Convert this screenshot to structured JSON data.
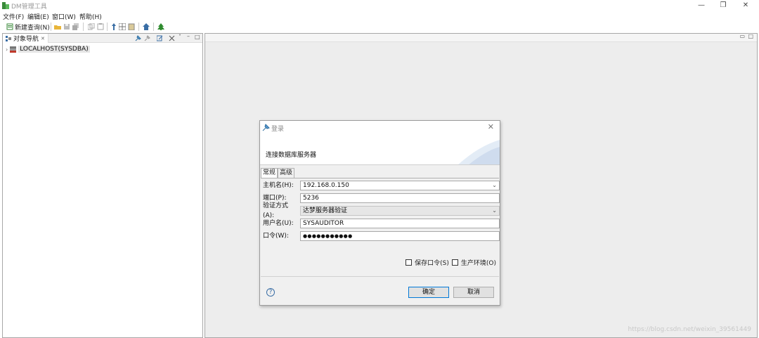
{
  "window": {
    "title": "DM管理工具",
    "minimize": "—",
    "maximize": "❐",
    "close": "✕"
  },
  "menu": [
    "文件(F)",
    "编辑(E)",
    "窗口(W)",
    "帮助(H)"
  ],
  "toolbar": {
    "new_query_label": "新建查询(N)",
    "icons": [
      "open-folder-icon",
      "save-icon",
      "save-all-icon",
      "copy-icon",
      "paste-icon",
      "pin-icon",
      "grid-icon",
      "clipboard-icon",
      "home-icon",
      "tree-icon"
    ]
  },
  "navigator": {
    "tab_label": "对象导航",
    "tab_close": "✕",
    "tree": [
      {
        "label": "LOCALHOST(SYSDBA)",
        "expander": "›"
      }
    ]
  },
  "dialog": {
    "title": "登录",
    "close": "✕",
    "subtitle": "连接数据库服务器",
    "tabs": [
      {
        "label": "常规",
        "active": true
      },
      {
        "label": "高级",
        "active": false
      }
    ],
    "fields": {
      "host": {
        "label": "主机名(H):",
        "value": "192.168.0.150",
        "dropdown": true
      },
      "port": {
        "label": "端口(P):",
        "value": "5236"
      },
      "auth": {
        "label": "验证方式(A):",
        "value": "达梦服务器验证",
        "dropdown": true,
        "disabled": true
      },
      "user": {
        "label": "用户名(U):",
        "value": "SYSAUDITOR"
      },
      "password": {
        "label": "口令(W):",
        "value": "●●●●●●●●●●●"
      }
    },
    "save_password": {
      "label": "保存口令(S)",
      "checked": false
    },
    "production_env": {
      "label": "生产环境(O)",
      "checked": false
    },
    "help": "?",
    "ok_label": "确定",
    "cancel_label": "取消"
  },
  "watermark": "https://blog.csdn.net/weixin_39561449",
  "colors": {
    "accent": "#0078d7",
    "panel_bg": "#ededed",
    "dialog_bg": "#f0f0f0"
  }
}
